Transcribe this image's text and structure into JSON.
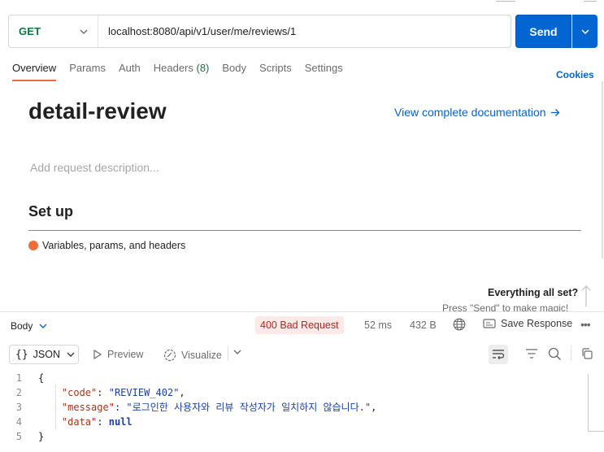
{
  "request": {
    "method": "GET",
    "url": "localhost:8080/api/v1/user/me/reviews/1",
    "send_label": "Send"
  },
  "request_tabs": [
    {
      "label": "Overview",
      "active": true
    },
    {
      "label": "Params"
    },
    {
      "label": "Auth"
    },
    {
      "label": "Headers",
      "count": "(8)"
    },
    {
      "label": "Body"
    },
    {
      "label": "Scripts"
    },
    {
      "label": "Settings"
    }
  ],
  "cookies_label": "Cookies",
  "overview": {
    "title": "detail-review",
    "doc_link": "View complete documentation",
    "description_placeholder": "Add request description...",
    "setup_title": "Set up",
    "setup_item": "Variables, params, and headers",
    "ready_title": "Everything all set?",
    "ready_sub": "Press \"Send\" to make magic!"
  },
  "response": {
    "body_label": "Body",
    "status": "400 Bad Request",
    "time": "52 ms",
    "size": "432 B",
    "save_label": "Save Response",
    "format_label": "JSON",
    "preview_label": "Preview",
    "visualize_label": "Visualize",
    "code_lines": [
      {
        "num": "1"
      },
      {
        "num": "2",
        "key": "\"code\"",
        "value": "\"REVIEW_402\"",
        "trail": ","
      },
      {
        "num": "3",
        "key": "\"message\"",
        "value": "\"로그인한 사용자와 리뷰 작성자가 일치하지 않습니다.\"",
        "trail": ","
      },
      {
        "num": "4",
        "key": "\"data\"",
        "value": "null"
      },
      {
        "num": "5"
      }
    ],
    "open_brace": "{",
    "close_brace": "}"
  },
  "colors": {
    "accent": "#0265d2",
    "get_method": "#0c7a43",
    "active_tab": "#f26b3a",
    "error_badge_bg": "#fde9e7",
    "error_badge_text": "#b3261e"
  }
}
